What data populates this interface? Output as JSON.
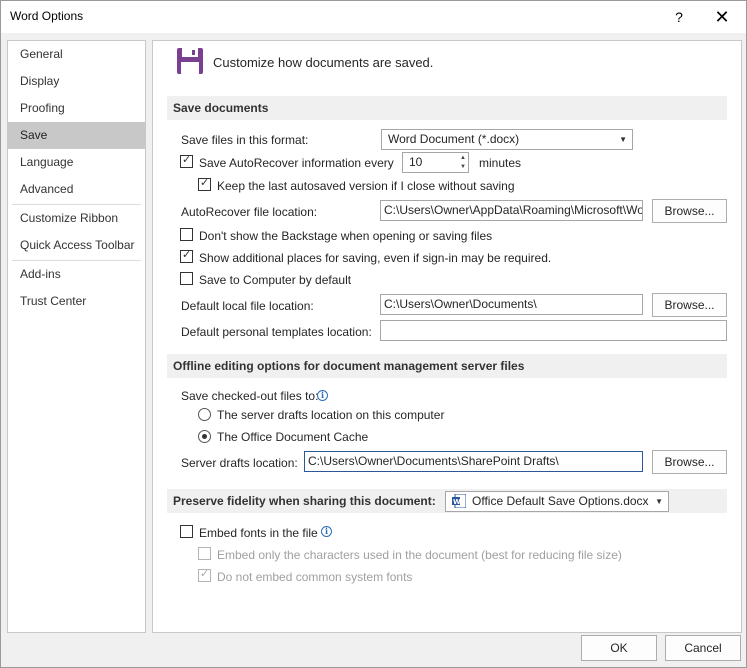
{
  "window": {
    "title": "Word Options",
    "help_label": "?",
    "close_label": "✕"
  },
  "nav": {
    "items": [
      {
        "label": "General"
      },
      {
        "label": "Display"
      },
      {
        "label": "Proofing"
      },
      {
        "label": "Save"
      },
      {
        "label": "Language"
      },
      {
        "label": "Advanced"
      },
      {
        "label": "Customize Ribbon"
      },
      {
        "label": "Quick Access Toolbar"
      },
      {
        "label": "Add-ins"
      },
      {
        "label": "Trust Center"
      }
    ],
    "active": "Save"
  },
  "header": {
    "text": "Customize how documents are saved.",
    "icon": "floppy-disk-icon"
  },
  "save_documents": {
    "title": "Save documents",
    "format_label": "Save files in this format:",
    "format_value": "Word Document (*.docx)",
    "autorecover_label": "Save AutoRecover information every",
    "autorecover_checked": true,
    "autorecover_minutes": "10",
    "minutes_label": "minutes",
    "keep_last_label": "Keep the last autosaved version if I close without saving",
    "keep_last_checked": true,
    "autorecover_location_label": "AutoRecover file location:",
    "autorecover_location_value": "C:\\Users\\Owner\\AppData\\Roaming\\Microsoft\\Word\\",
    "browse_label": "Browse...",
    "backstage_label": "Don't show the Backstage when opening or saving files",
    "backstage_checked": false,
    "additional_places_label": "Show additional places for saving, even if sign-in may be required.",
    "additional_places_checked": true,
    "save_to_computer_label": "Save to Computer by default",
    "save_to_computer_checked": false,
    "default_local_label": "Default local file location:",
    "default_local_value": "C:\\Users\\Owner\\Documents\\",
    "default_templates_label": "Default personal templates location:",
    "default_templates_value": ""
  },
  "offline": {
    "title": "Offline editing options for document management server files",
    "checked_out_label": "Save checked-out files to:",
    "radio_server_label": "The server drafts location on this computer",
    "radio_cache_label": "The Office Document Cache",
    "selected": "cache",
    "server_drafts_label": "Server drafts location:",
    "server_drafts_value": "C:\\Users\\Owner\\Documents\\SharePoint Drafts\\"
  },
  "fidelity": {
    "title": "Preserve fidelity when sharing this document:",
    "document_value": "Office Default Save Options.docx",
    "embed_fonts_label": "Embed fonts in the file",
    "embed_fonts_checked": false,
    "embed_only_label": "Embed only the characters used in the document (best for reducing file size)",
    "embed_only_checked": false,
    "no_common_label": "Do not embed common system fonts",
    "no_common_checked": true
  },
  "footer": {
    "ok_label": "OK",
    "cancel_label": "Cancel"
  },
  "colors": {
    "accent": "#2b579a",
    "floppy": "#7a3f8e",
    "section_bg": "#f0f0f0",
    "nav_active": "#c8c8c8"
  }
}
